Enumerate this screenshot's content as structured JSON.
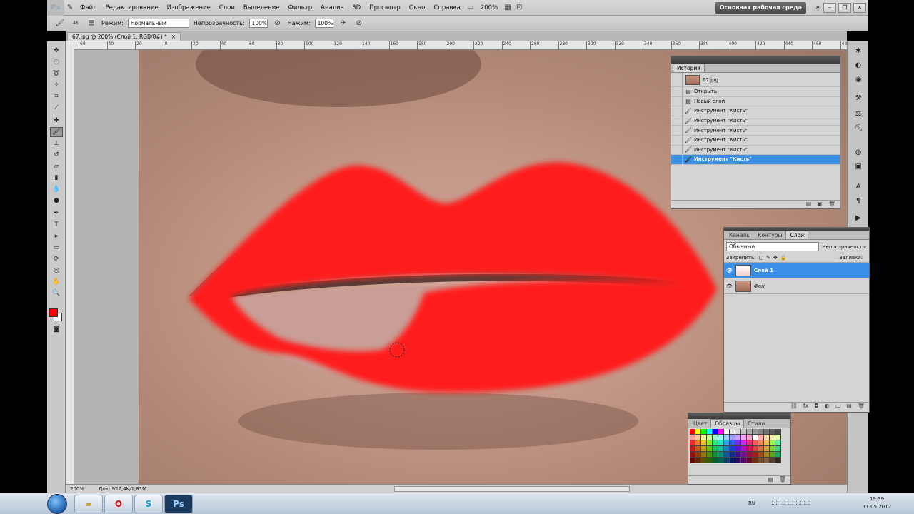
{
  "menu": {
    "logo": "Ps",
    "items": [
      "Файл",
      "Редактирование",
      "Изображение",
      "Слои",
      "Выделение",
      "Фильтр",
      "Анализ",
      "3D",
      "Просмотр",
      "Окно",
      "Справка"
    ],
    "zoom": "200%",
    "workspace": "Основная рабочая среда"
  },
  "options": {
    "brush_size": "46",
    "mode_label": "Режим:",
    "mode_value": "Нормальный",
    "opacity_label": "Непрозрачность:",
    "opacity_value": "100%",
    "flow_label": "Нажим:",
    "flow_value": "100%"
  },
  "document": {
    "tab_title": "67.jpg @ 200% (Слой 1, RGB/8#) *",
    "close": "×"
  },
  "ruler": {
    "top_ticks": [
      "60",
      "40",
      "20",
      "0",
      "20",
      "40",
      "60",
      "80",
      "100",
      "120",
      "140",
      "160",
      "180",
      "200",
      "220",
      "240",
      "260",
      "280",
      "300",
      "320",
      "340",
      "360",
      "380",
      "400",
      "420",
      "440",
      "460",
      "480"
    ]
  },
  "status": {
    "zoom": "200%",
    "doc": "Док: 927,4K/1,81M"
  },
  "history": {
    "title": "История",
    "snapshot": "67.jpg",
    "rows": [
      {
        "label": "Открыть",
        "selected": false
      },
      {
        "label": "Новый слой",
        "selected": false
      },
      {
        "label": "Инструмент \"Кисть\"",
        "selected": false
      },
      {
        "label": "Инструмент \"Кисть\"",
        "selected": false
      },
      {
        "label": "Инструмент \"Кисть\"",
        "selected": false
      },
      {
        "label": "Инструмент \"Кисть\"",
        "selected": false
      },
      {
        "label": "Инструмент \"Кисть\"",
        "selected": false
      },
      {
        "label": "Инструмент \"Кисть\"",
        "selected": true
      }
    ]
  },
  "layers": {
    "tabs": [
      "Каналы",
      "Контуры",
      "Слои"
    ],
    "blend": "Обычные",
    "opacity_label": "Непрозрачность:",
    "lock_label": "Закрепить:",
    "fill_label": "Заливка:",
    "rows": [
      {
        "name": "Слой 1",
        "selected": true
      },
      {
        "name": "Фон",
        "selected": false
      }
    ]
  },
  "swatches": {
    "tabs": [
      "Цвет",
      "Образцы",
      "Стили"
    ],
    "colors": [
      "#ff0000",
      "#ffff00",
      "#00ff00",
      "#00ffff",
      "#0000ff",
      "#ff00ff",
      "#ffffff",
      "#ebebeb",
      "#d6d6d6",
      "#c2c2c2",
      "#adadad",
      "#999999",
      "#858585",
      "#707070",
      "#5c5c5c",
      "#474747",
      "#f2a0a0",
      "#f2c8a0",
      "#f2f2a0",
      "#c8f2a0",
      "#a0f2c8",
      "#a0f2f2",
      "#a0c8f2",
      "#a0a0f2",
      "#c8a0f2",
      "#f2a0f2",
      "#f2a0c8",
      "#ffffff",
      "#ffb0b0",
      "#ffd9b0",
      "#fff0b0",
      "#d9ffb0",
      "#e63030",
      "#e67a30",
      "#e6c430",
      "#9ae630",
      "#30e67a",
      "#30e6c4",
      "#30a8e6",
      "#305ee6",
      "#7a30e6",
      "#c430e6",
      "#e6307a",
      "#f06060",
      "#f09060",
      "#f0c060",
      "#a0f060",
      "#60f0a0",
      "#c01818",
      "#c05a18",
      "#c0a018",
      "#70c018",
      "#18c05a",
      "#18c0a0",
      "#1880c0",
      "#1840c0",
      "#5a18c0",
      "#a018c0",
      "#c0185a",
      "#d04040",
      "#d07040",
      "#d0a040",
      "#80d040",
      "#40d080",
      "#901010",
      "#904010",
      "#907810",
      "#509010",
      "#109040",
      "#109078",
      "#105c90",
      "#102c90",
      "#401090",
      "#781090",
      "#901040",
      "#a02020",
      "#a05020",
      "#a08020",
      "#60a020",
      "#20a060",
      "#600808",
      "#602808",
      "#605008",
      "#306008",
      "#086028",
      "#086050",
      "#083c60",
      "#081860",
      "#280860",
      "#500860",
      "#600828",
      "#703010",
      "#705030",
      "#806040",
      "#504030",
      "#302820"
    ]
  },
  "taskbar": {
    "items": [
      "files",
      "opera",
      "skype",
      "photoshop"
    ],
    "lang": "RU",
    "time": "19:39",
    "date": "11.05.2012"
  }
}
